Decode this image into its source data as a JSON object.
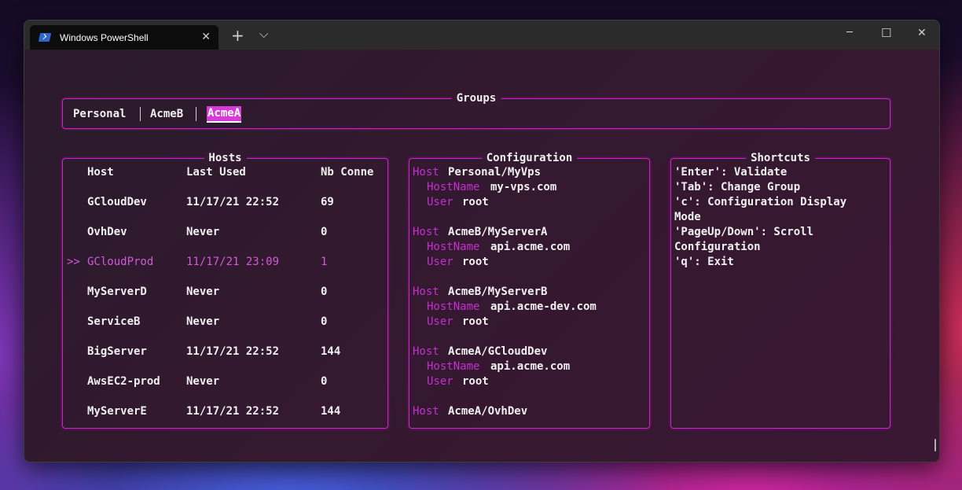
{
  "window": {
    "tab_title": "Windows PowerShell",
    "tab_close": "✕",
    "new_tab": "+",
    "dropdown": "⌵",
    "minimize": "─",
    "maximize": "☐",
    "close": "✕"
  },
  "groups": {
    "title": "Groups",
    "items": [
      "Personal",
      "AcmeB",
      "AcmeA"
    ],
    "active_index": 2
  },
  "hosts": {
    "title": "Hosts",
    "headers": [
      "Host",
      "Last Used",
      "Nb Conne"
    ],
    "selected_marker": ">>",
    "rows": [
      {
        "host": "GCloudDev",
        "last_used": "11/17/21 22:52",
        "nb": "69"
      },
      {
        "host": "OvhDev",
        "last_used": "Never",
        "nb": "0"
      },
      {
        "host": "GCloudProd",
        "last_used": "11/17/21 23:09",
        "nb": "1",
        "selected": true
      },
      {
        "host": "MyServerD",
        "last_used": "Never",
        "nb": "0"
      },
      {
        "host": "ServiceB",
        "last_used": "Never",
        "nb": "0"
      },
      {
        "host": "BigServer",
        "last_used": "11/17/21 22:52",
        "nb": "144"
      },
      {
        "host": "AwsEC2-prod",
        "last_used": "Never",
        "nb": "0"
      },
      {
        "host": "MyServerE",
        "last_used": "11/17/21 22:52",
        "nb": "144"
      }
    ]
  },
  "configuration": {
    "title": "Configuration",
    "host_kw": "Host",
    "hostname_kw": "HostName",
    "user_kw": "User",
    "entries": [
      {
        "host": "Personal/MyVps",
        "hostname": "my-vps.com",
        "user": "root"
      },
      {
        "host": "AcmeB/MyServerA",
        "hostname": "api.acme.com",
        "user": "root"
      },
      {
        "host": "AcmeB/MyServerB",
        "hostname": "api.acme-dev.com",
        "user": "root"
      },
      {
        "host": "AcmeA/GCloudDev",
        "hostname": "api.acme.com",
        "user": "root"
      },
      {
        "host": "AcmeA/OvhDev"
      }
    ]
  },
  "shortcuts": {
    "title": "Shortcuts",
    "lines": [
      "'Enter': Validate",
      "'Tab': Change Group",
      "'c': Configuration Display",
      "Mode",
      "'PageUp/Down': Scroll",
      "Configuration",
      "'q': Exit"
    ]
  },
  "colors": {
    "border": "#d21ed2",
    "keyword": "#c42fd0",
    "selected": "#d05ad8",
    "text": "#f0f0f0"
  }
}
